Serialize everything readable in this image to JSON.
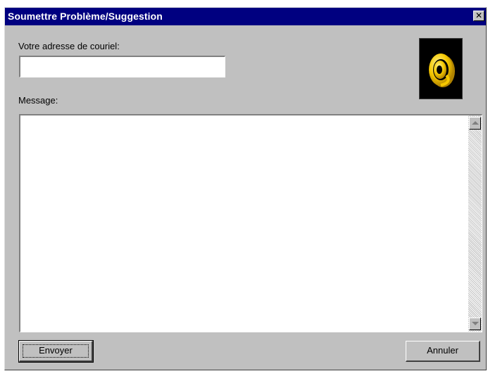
{
  "window": {
    "title": "Soumettre Problème/Suggestion",
    "close_glyph": "✕"
  },
  "form": {
    "email_label": "Votre adresse de couriel:",
    "email_value": "",
    "message_label": "Message:",
    "message_value": ""
  },
  "buttons": {
    "send_label": "Envoyer",
    "cancel_label": "Annuler"
  },
  "icons": {
    "logo": "at-sign-logo-icon",
    "scroll_up": "scroll-up-arrow-icon",
    "scroll_down": "scroll-down-arrow-icon"
  },
  "colors": {
    "titlebar": "#000080",
    "window_face": "#c0c0c0",
    "logo_gold": "#f5c800"
  }
}
